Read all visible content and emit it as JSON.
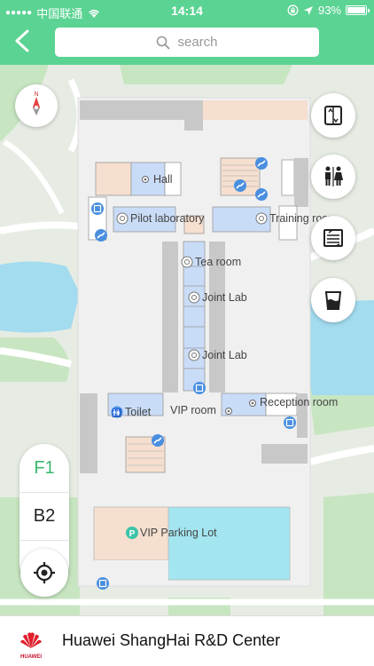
{
  "status_bar": {
    "carrier": "中国联通",
    "time": "14:14",
    "battery": "93%"
  },
  "search": {
    "placeholder": "search"
  },
  "map": {
    "rooms": [
      "Hall",
      "Pilot laboratory",
      "Training room",
      "Tea room",
      "Joint Lab",
      "Joint Lab",
      "Toilet",
      "VIP room",
      "Reception room",
      "VIP Parking Lot"
    ]
  },
  "floors": [
    "F1",
    "B2",
    "P"
  ],
  "active_floor": "F1",
  "footer": {
    "title": "Huawei ShangHai R&D Center",
    "logo_text": "HUAWEI"
  },
  "colors": {
    "header": "#5bd393",
    "accent": "#3cb86e",
    "water": "#a3dbef",
    "grass": "#c7e5c1",
    "building": "#f0f0f0",
    "blue_room": "#c9dcf7",
    "peach_room": "#f6dfcf",
    "icon_blue": "#4a8fe0"
  },
  "icons": {
    "back": "chevron-left-icon",
    "search": "search-icon",
    "compass": "compass-icon",
    "elevator": "elevator-icon",
    "restroom": "restroom-icon",
    "escalator": "escalator-icon",
    "water": "water-icon",
    "locate": "locate-icon"
  }
}
